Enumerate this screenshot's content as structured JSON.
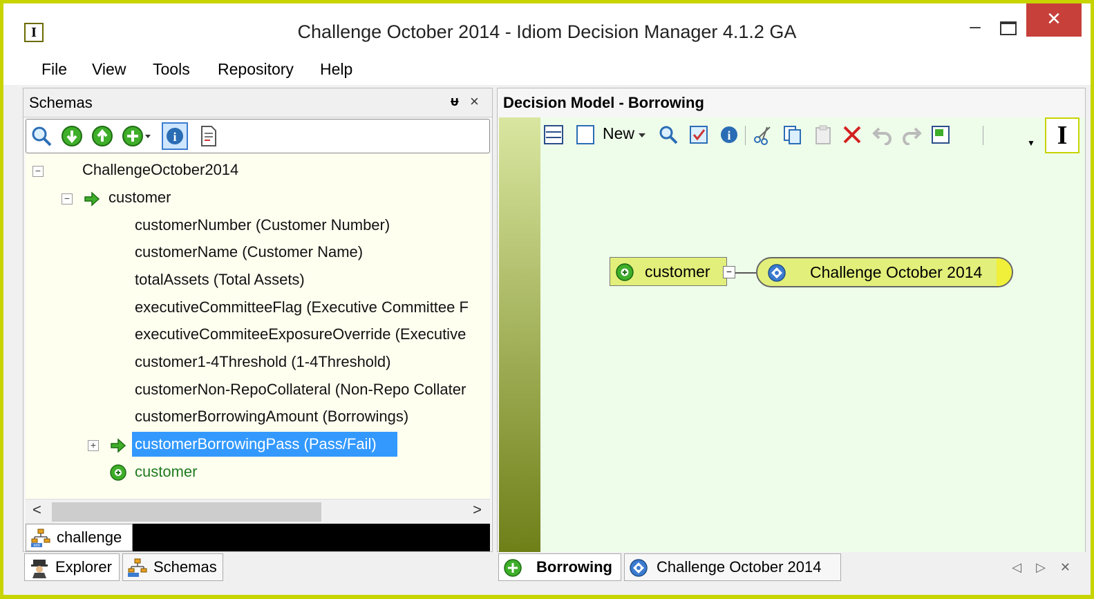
{
  "window": {
    "title": "Challenge October 2014 - Idiom Decision Manager 4.1.2 GA",
    "app_icon_glyph": "I",
    "min_glyph": "–",
    "close_glyph": "✕"
  },
  "menu": [
    "File",
    "View",
    "Tools",
    "Repository",
    "Help"
  ],
  "schemas_panel": {
    "title": "Schemas",
    "pin_glyph": "ᵾ",
    "close_glyph": "×",
    "toolbar_icons": [
      "zoom-icon",
      "move-down-icon",
      "move-up-icon",
      "add-dropdown-icon",
      "info-icon",
      "document-icon"
    ],
    "tree": {
      "root": "ChallengeOctober2014",
      "customer_group": "customer",
      "fields": [
        "customerNumber (Customer Number)",
        "customerName (Customer Name)",
        "totalAssets (Total Assets)",
        "executiveCommitteeFlag (Executive Committee F",
        "executiveCommiteeExposureOverride (Executive",
        "customer1-4Threshold (1-4Threshold)",
        "customerNon-RepoCollateral (Non-Repo Collater",
        "customerBorrowingAmount (Borrowings)"
      ],
      "selected": "customerBorrowingPass (Pass/Fail)",
      "customer_element": "customer"
    },
    "file_tab": "challenge",
    "expand_glyph": "⊟",
    "collapse_glyph": "⊞",
    "scroll_left": "<",
    "scroll_right": ">"
  },
  "left_bottom_tabs": [
    "Explorer",
    "Schemas"
  ],
  "decision_model": {
    "title": "Decision Model -  Borrowing",
    "new_label": "New",
    "cursor_glyph": "I",
    "nodes": {
      "customer": "customer",
      "challenge": "Challenge October 2014"
    },
    "collapse_glyph": "−"
  },
  "right_bottom_tabs": [
    "Borrowing",
    "Challenge October 2014"
  ],
  "right_bottom_nav": "◁ ▷ ✕"
}
